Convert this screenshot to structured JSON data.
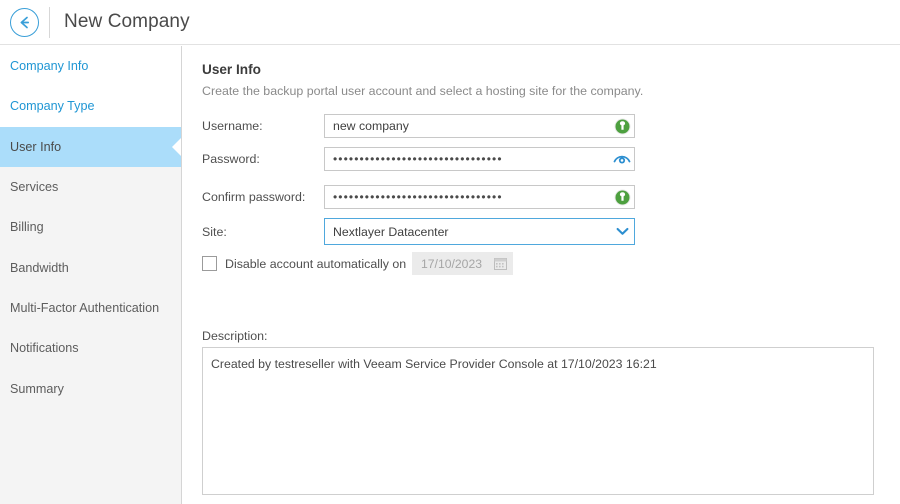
{
  "header": {
    "title": "New Company",
    "back_icon": "back-arrow-circle-icon"
  },
  "sidebar": {
    "items": [
      {
        "label": "Company Info",
        "state": "done"
      },
      {
        "label": "Company Type",
        "state": "done"
      },
      {
        "label": "User Info",
        "state": "active"
      },
      {
        "label": "Services",
        "state": "pending"
      },
      {
        "label": "Billing",
        "state": "pending"
      },
      {
        "label": "Bandwidth",
        "state": "pending"
      },
      {
        "label": "Multi-Factor Authentication",
        "state": "pending"
      },
      {
        "label": "Notifications",
        "state": "pending"
      },
      {
        "label": "Summary",
        "state": "pending"
      }
    ]
  },
  "main": {
    "section_title": "User Info",
    "section_subtitle": "Create the backup portal user account and select a hosting site for the company.",
    "fields": {
      "username": {
        "label": "Username:",
        "value": "new company",
        "placeholder": "",
        "adorn_icon": "validation-ok-icon"
      },
      "password": {
        "label": "Password:",
        "value": "••••••••••••••••••••••••••••••••",
        "adorn_icon": "reveal-password-eye-icon"
      },
      "confirm_password": {
        "label": "Confirm password:",
        "value": "••••••••••••••••••••••••••••••••",
        "adorn_icon": "validation-ok-icon"
      },
      "site": {
        "label": "Site:",
        "value": "Nextlayer Datacenter",
        "adorn_icon": "chevron-down-icon",
        "options": [
          "Nextlayer Datacenter"
        ]
      }
    },
    "disable_account": {
      "label": "Disable account automatically on",
      "checked": false,
      "date_value": "17/10/2023",
      "date_enabled": false,
      "calendar_icon": "calendar-icon"
    },
    "description": {
      "label": "Description:",
      "value": "Created by testreseller with Veeam Service Provider Console at 17/10/2023 16:21"
    }
  },
  "colors": {
    "accent": "#1f96d4",
    "active_item_bg": "#abddfa",
    "sidebar_bg": "#f4f4f4",
    "validation_green": "#3b9b33",
    "eye_blue": "#2d8fd0"
  }
}
